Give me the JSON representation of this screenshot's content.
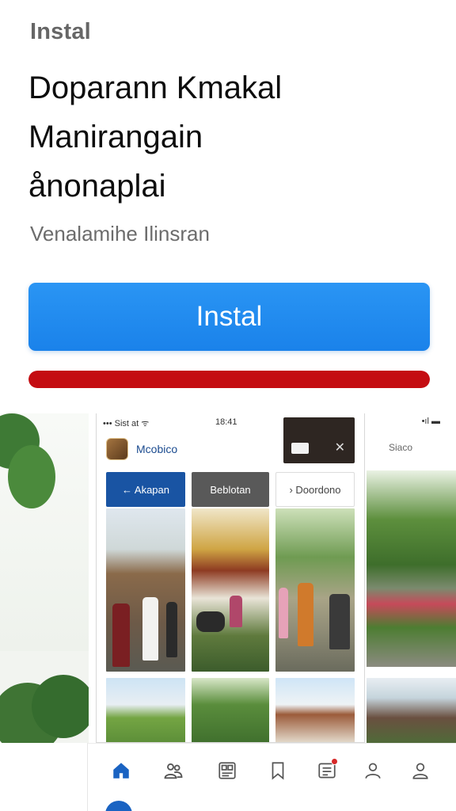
{
  "header": {
    "brand": "Instal",
    "headline_lines": [
      "Doparann Kmakal",
      "Manirangain",
      "ånonaplai"
    ],
    "subtitle": "Venalamihe Ilinsran"
  },
  "install_button": {
    "label": "Instal",
    "color": "#1a82ea"
  },
  "progress": {
    "value": 1.0,
    "color": "#c40d12"
  },
  "screenshot_main": {
    "status_left": "••• Sist at ᯤ",
    "status_time": "18:41",
    "app_name": "Mcobico",
    "tabs": [
      {
        "label": "← Akapan"
      },
      {
        "label": "Beblotan"
      },
      {
        "label": "› Doordono"
      }
    ]
  },
  "screenshot_right": {
    "status": "•ıl ▬",
    "label": "Siaco"
  },
  "nav": {
    "items": [
      {
        "icon": "home-icon",
        "active": true
      },
      {
        "icon": "people-icon",
        "active": false
      },
      {
        "icon": "grid-icon",
        "active": false
      },
      {
        "icon": "bookmark-icon",
        "active": false
      },
      {
        "icon": "list-icon",
        "active": false,
        "badge": true
      },
      {
        "icon": "person-icon",
        "active": false
      },
      {
        "icon": "profile-icon",
        "active": false
      }
    ],
    "active_color": "#1a63c2",
    "inactive_color": "#555555"
  }
}
